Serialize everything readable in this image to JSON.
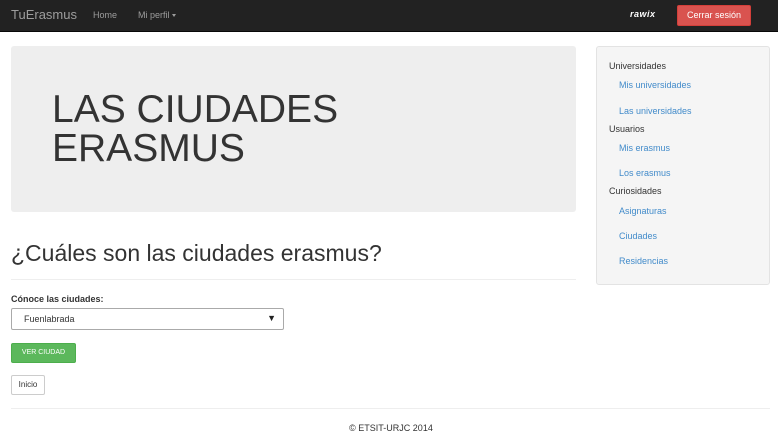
{
  "navbar": {
    "brand": "TuErasmus",
    "home": "Home",
    "profile": "Mi perfil",
    "username": "rawix",
    "logout": "Cerrar sesión",
    "colors": {
      "background": "#222222",
      "logout": "#d9534f"
    }
  },
  "jumbotron": {
    "title": "LAS CIUDADES ERASMUS"
  },
  "main": {
    "heading": "¿Cuáles son las ciudades erasmus?",
    "form_label": "Cónoce las ciudades:",
    "select_value": "Fuenlabrada",
    "submit": "VER CIUDAD",
    "back": "Inicio"
  },
  "sidebar": {
    "sections": [
      {
        "title": "Universidades",
        "links": [
          "Mis universidades",
          "Las universidades"
        ]
      },
      {
        "title": "Usuarios",
        "links": [
          "Mis erasmus",
          "Los erasmus"
        ]
      },
      {
        "title": "Curiosidades",
        "links": [
          "Asignaturas",
          "Ciudades",
          "Residencias"
        ]
      }
    ]
  },
  "footer": {
    "text": "© ETSIT-URJC 2014"
  },
  "icons": {
    "dropdown_caret": "caret-down-icon",
    "select_arrow": "▼"
  }
}
